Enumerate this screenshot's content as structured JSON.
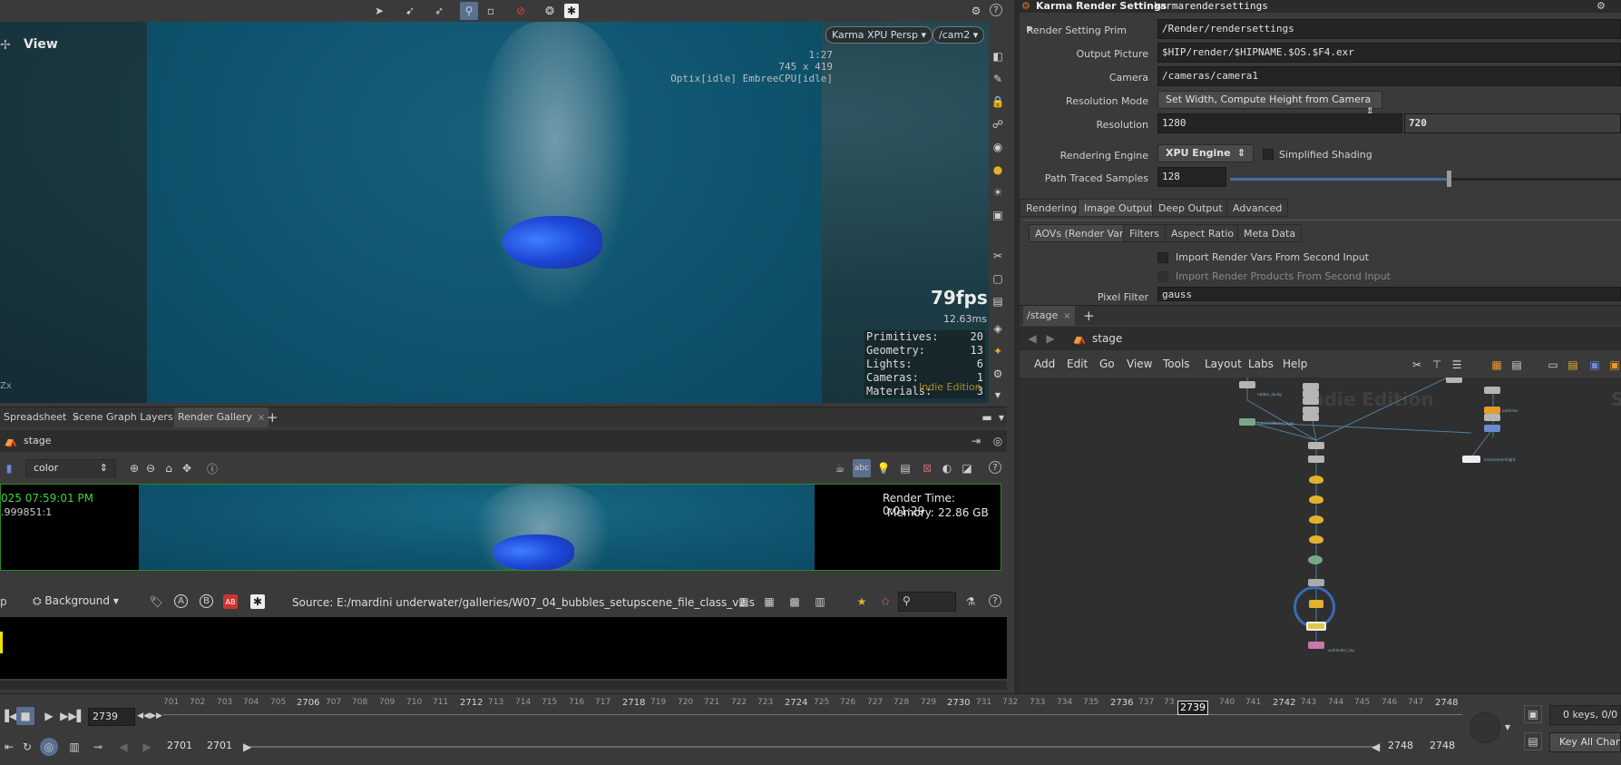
{
  "viewport": {
    "title": "View",
    "renderer_menu": "Karma XPU  Persp",
    "camera_menu": "/cam2",
    "info_lines": [
      "1:27",
      "745 x 419",
      "Optix[idle] EmbreeCPU[idle]"
    ],
    "fps": "79fps",
    "frame_ms": "12.63ms",
    "stats": [
      {
        "label": "Primitives:",
        "value": "20"
      },
      {
        "label": "Geometry:",
        "value": "13"
      },
      {
        "label": "Lights:",
        "value": "6"
      },
      {
        "label": "Cameras:",
        "value": "1"
      },
      {
        "label": "Materials:",
        "value": "3"
      }
    ],
    "watermark": "Indie Edition",
    "corner_glyph": "Zx"
  },
  "bottom_left": {
    "tabs": [
      "Spreadsheet",
      "Scene Graph Layers",
      "Render Gallery"
    ],
    "path": "stage",
    "aov_menu": "color",
    "render_date": "025 07:59:01 PM",
    "render_id": ".999851:1",
    "render_time": "Render Time: 0:01:29",
    "memory_label": "Memory:",
    "memory_value": "22.86 GB",
    "bg_menu": "Background",
    "bg_left_text": "p",
    "source_label": "Source: E:/mardini underwater/galleries/W07_04_bubbles_setupscene_file_class_v2.s",
    "badge_a": "A",
    "badge_b": "B",
    "badge_ab": "AB"
  },
  "params": {
    "node_type": "Karma Render Settings",
    "node_name": "karmarendersettings",
    "rows": {
      "render_setting_prim_label": "Render Setting Prim",
      "render_setting_prim": "/Render/rendersettings",
      "output_picture_label": "Output Picture",
      "output_picture": "$HIP/render/$HIPNAME.$OS.$F4.exr",
      "camera_label": "Camera",
      "camera": "/cameras/camera1",
      "resolution_mode_label": "Resolution Mode",
      "resolution_mode": "Set Width, Compute Height from Camera",
      "resolution_label": "Resolution",
      "resolution_w": "1280",
      "resolution_h": "720",
      "rendering_engine_label": "Rendering Engine",
      "rendering_engine": "XPU Engine",
      "simplified_shading": "Simplified Shading",
      "path_traced_samples_label": "Path Traced Samples",
      "path_traced_samples": "128"
    },
    "tabs": [
      "Rendering",
      "Image Output",
      "Deep Output",
      "Advanced"
    ],
    "subtabs": [
      "AOVs (Render Vars)",
      "Filters",
      "Aspect Ratio",
      "Meta Data"
    ],
    "import_vars": "Import Render Vars From Second Input",
    "import_products": "Import Render Products From Second Input",
    "pixel_filter_label": "Pixel Filter",
    "pixel_filter": "gauss"
  },
  "network": {
    "tab": "/stage",
    "path": "stage",
    "menus": [
      "Add",
      "Edit",
      "Go",
      "View",
      "Tools",
      "Layout",
      "Labs",
      "Help"
    ],
    "watermark": "Indie Edition",
    "right_letter": "S"
  },
  "timeline": {
    "current_frame": "2739",
    "marker": "2739",
    "ticks": [
      {
        "label": "701",
        "major": false
      },
      {
        "label": "702",
        "major": false
      },
      {
        "label": "703",
        "major": false
      },
      {
        "label": "704",
        "major": false
      },
      {
        "label": "705",
        "major": false
      },
      {
        "label": "2706",
        "major": true
      },
      {
        "label": "707",
        "major": false
      },
      {
        "label": "708",
        "major": false
      },
      {
        "label": "709",
        "major": false
      },
      {
        "label": "710",
        "major": false
      },
      {
        "label": "711",
        "major": false
      },
      {
        "label": "2712",
        "major": true
      },
      {
        "label": "713",
        "major": false
      },
      {
        "label": "714",
        "major": false
      },
      {
        "label": "715",
        "major": false
      },
      {
        "label": "716",
        "major": false
      },
      {
        "label": "717",
        "major": false
      },
      {
        "label": "2718",
        "major": true
      },
      {
        "label": "719",
        "major": false
      },
      {
        "label": "720",
        "major": false
      },
      {
        "label": "721",
        "major": false
      },
      {
        "label": "722",
        "major": false
      },
      {
        "label": "723",
        "major": false
      },
      {
        "label": "2724",
        "major": true
      },
      {
        "label": "725",
        "major": false
      },
      {
        "label": "726",
        "major": false
      },
      {
        "label": "727",
        "major": false
      },
      {
        "label": "728",
        "major": false
      },
      {
        "label": "729",
        "major": false
      },
      {
        "label": "2730",
        "major": true
      },
      {
        "label": "731",
        "major": false
      },
      {
        "label": "732",
        "major": false
      },
      {
        "label": "733",
        "major": false
      },
      {
        "label": "734",
        "major": false
      },
      {
        "label": "735",
        "major": false
      },
      {
        "label": "2736",
        "major": true
      },
      {
        "label": "737",
        "major": false
      },
      {
        "label": "73",
        "major": false
      },
      {
        "label": "740",
        "major": false
      },
      {
        "label": "741",
        "major": false
      },
      {
        "label": "2742",
        "major": true
      },
      {
        "label": "743",
        "major": false
      },
      {
        "label": "744",
        "major": false
      },
      {
        "label": "745",
        "major": false
      },
      {
        "label": "746",
        "major": false
      },
      {
        "label": "747",
        "major": false
      },
      {
        "label": "2748",
        "major": true
      }
    ],
    "range_start": "2701",
    "range_start2": "2701",
    "range_end": "2748",
    "range_end2": "2748",
    "keys_label": "0 keys, 0/0 ch",
    "key_all": "Key All Chann"
  }
}
